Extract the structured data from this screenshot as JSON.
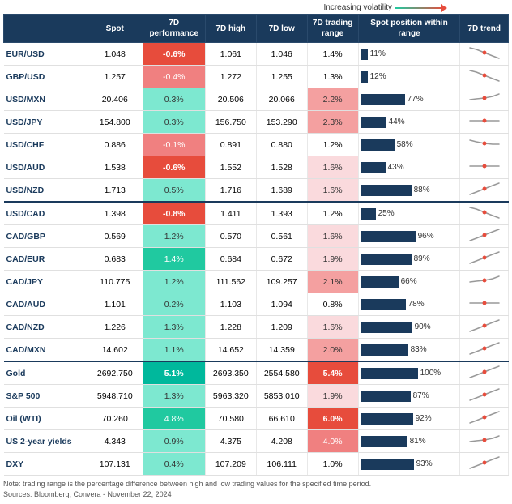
{
  "volatility": {
    "label": "Increasing volatility"
  },
  "headers": {
    "pair": "",
    "spot": "Spot",
    "perf7d": "7D performance",
    "high7d": "7D high",
    "low7d": "7D low",
    "range7d": "7D trading range",
    "spotpos": "Spot position within range",
    "trend7d": "7D trend"
  },
  "rows": [
    {
      "pair": "EUR/USD",
      "spot": "1.048",
      "perf": "-0.6%",
      "high": "1.061",
      "low": "1.046",
      "range": "1.4%",
      "spotpct": 11,
      "trend": "down"
    },
    {
      "pair": "GBP/USD",
      "spot": "1.257",
      "perf": "-0.4%",
      "high": "1.272",
      "low": "1.255",
      "range": "1.3%",
      "spotpct": 12,
      "trend": "down"
    },
    {
      "pair": "USD/MXN",
      "spot": "20.406",
      "perf": "0.3%",
      "high": "20.506",
      "low": "20.066",
      "range": "2.2%",
      "spotpct": 77,
      "trend": "flat-up"
    },
    {
      "pair": "USD/JPY",
      "spot": "154.800",
      "perf": "0.3%",
      "high": "156.750",
      "low": "153.290",
      "range": "2.3%",
      "spotpct": 44,
      "trend": "flat"
    },
    {
      "pair": "USD/CHF",
      "spot": "0.886",
      "perf": "-0.1%",
      "high": "0.891",
      "low": "0.880",
      "range": "1.2%",
      "spotpct": 58,
      "trend": "down-flat"
    },
    {
      "pair": "USD/AUD",
      "spot": "1.538",
      "perf": "-0.6%",
      "high": "1.552",
      "low": "1.528",
      "range": "1.6%",
      "spotpct": 43,
      "trend": "flat"
    },
    {
      "pair": "USD/NZD",
      "spot": "1.713",
      "perf": "0.5%",
      "high": "1.716",
      "low": "1.689",
      "range": "1.6%",
      "spotpct": 88,
      "trend": "up"
    },
    {
      "pair": "USD/CAD",
      "spot": "1.398",
      "perf": "-0.8%",
      "high": "1.411",
      "low": "1.393",
      "range": "1.2%",
      "spotpct": 25,
      "trend": "down",
      "divider": true
    },
    {
      "pair": "CAD/GBP",
      "spot": "0.569",
      "perf": "1.2%",
      "high": "0.570",
      "low": "0.561",
      "range": "1.6%",
      "spotpct": 96,
      "trend": "up"
    },
    {
      "pair": "CAD/EUR",
      "spot": "0.683",
      "perf": "1.4%",
      "high": "0.684",
      "low": "0.672",
      "range": "1.9%",
      "spotpct": 89,
      "trend": "up"
    },
    {
      "pair": "CAD/JPY",
      "spot": "110.775",
      "perf": "1.2%",
      "high": "111.562",
      "low": "109.257",
      "range": "2.1%",
      "spotpct": 66,
      "trend": "flat-up"
    },
    {
      "pair": "CAD/AUD",
      "spot": "1.101",
      "perf": "0.2%",
      "high": "1.103",
      "low": "1.094",
      "range": "0.8%",
      "spotpct": 78,
      "trend": "flat"
    },
    {
      "pair": "CAD/NZD",
      "spot": "1.226",
      "perf": "1.3%",
      "high": "1.228",
      "low": "1.209",
      "range": "1.6%",
      "spotpct": 90,
      "trend": "up"
    },
    {
      "pair": "CAD/MXN",
      "spot": "14.602",
      "perf": "1.1%",
      "high": "14.652",
      "low": "14.359",
      "range": "2.0%",
      "spotpct": 83,
      "trend": "up"
    },
    {
      "pair": "Gold",
      "spot": "2692.750",
      "perf": "5.1%",
      "high": "2693.350",
      "low": "2554.580",
      "range": "5.4%",
      "spotpct": 100,
      "trend": "up",
      "divider": true
    },
    {
      "pair": "S&P 500",
      "spot": "5948.710",
      "perf": "1.3%",
      "high": "5963.320",
      "low": "5853.010",
      "range": "1.9%",
      "spotpct": 87,
      "trend": "up"
    },
    {
      "pair": "Oil (WTI)",
      "spot": "70.260",
      "perf": "4.8%",
      "high": "70.580",
      "low": "66.610",
      "range": "6.0%",
      "spotpct": 92,
      "trend": "up"
    },
    {
      "pair": "US 2-year yields",
      "spot": "4.343",
      "perf": "0.9%",
      "high": "4.375",
      "low": "4.208",
      "range": "4.0%",
      "spotpct": 81,
      "trend": "flat-up"
    },
    {
      "pair": "DXY",
      "spot": "107.131",
      "perf": "0.4%",
      "high": "107.209",
      "low": "106.111",
      "range": "1.0%",
      "spotpct": 93,
      "trend": "up"
    }
  ],
  "note": "Note: trading range is the percentage difference between high and low trading values for the specified time period.",
  "source": "Sources: Bloomberg, Convera - November 22, 2024"
}
